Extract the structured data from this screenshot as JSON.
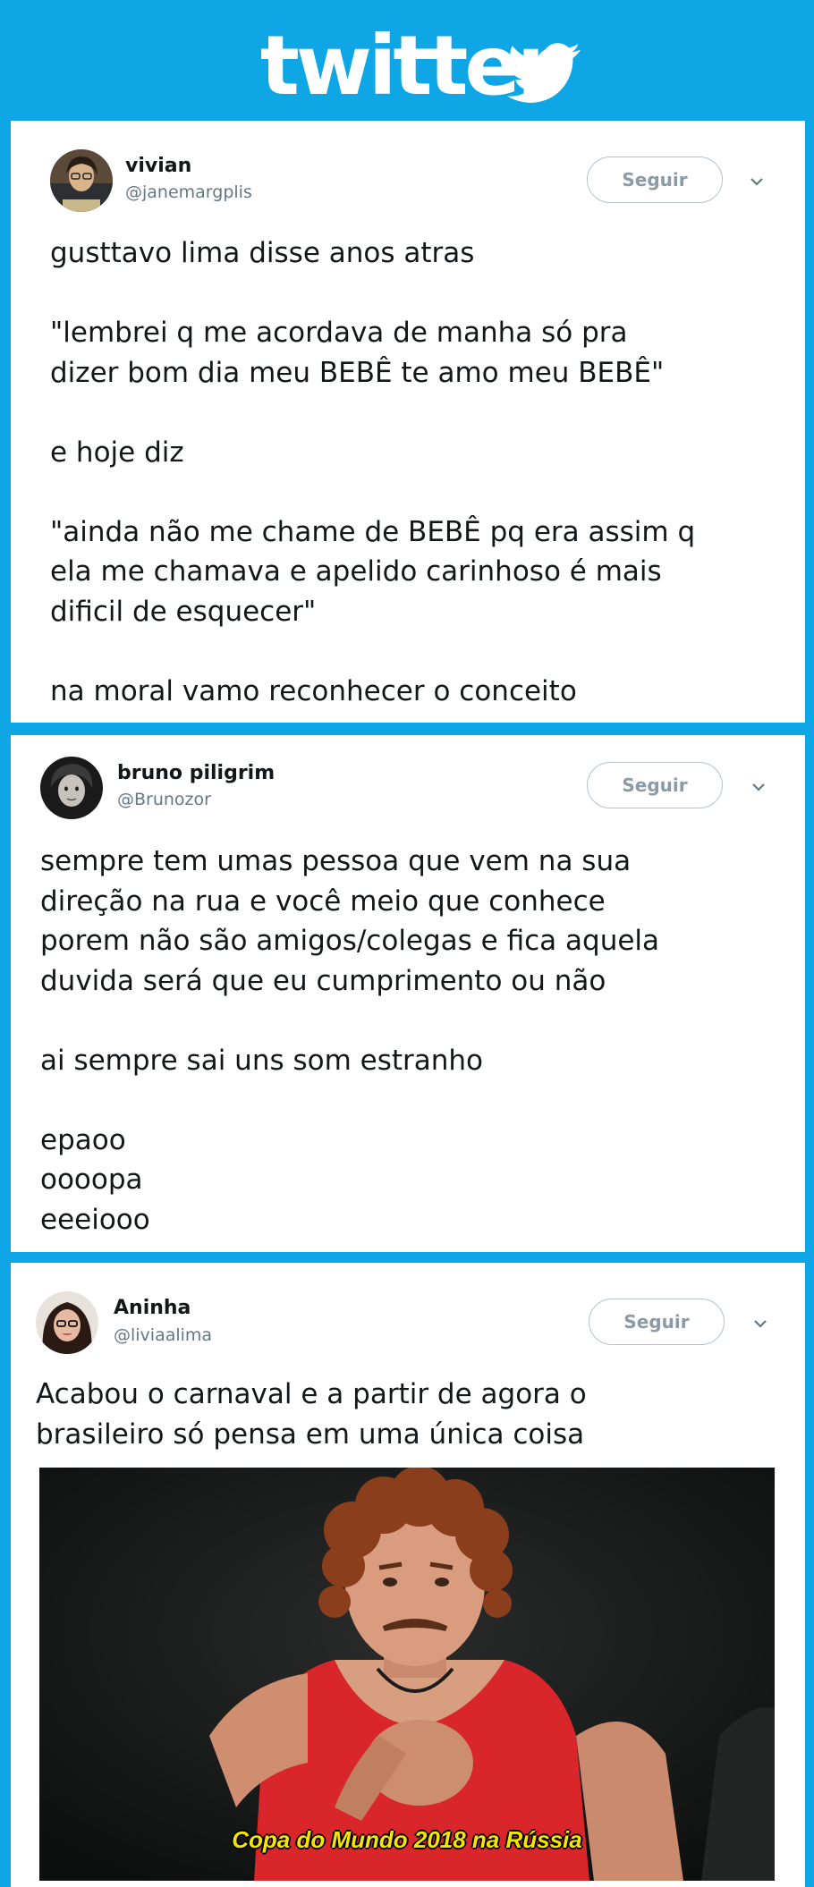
{
  "header": {
    "logo_text": "twitter"
  },
  "tweets": [
    {
      "name": "vivian",
      "handle": "@janemargplis",
      "follow_label": "Seguir",
      "text": "gusttavo lima disse anos atras\n\n\"lembrei q me acordava de manha só pra\ndizer bom dia meu BEBÊ te amo meu BEBÊ\"\n\ne hoje diz\n\n\"ainda não me chame de BEBÊ pq era assim q\nela me chamava e apelido carinhoso é mais\ndificil de esquecer\"\n\nna moral vamo reconhecer o conceito"
    },
    {
      "name": "bruno piligrim",
      "handle": "@Brunozor",
      "follow_label": "Seguir",
      "text": "sempre tem umas pessoa que vem na sua\ndireção na rua e você meio que conhece\nporem não são amigos/colegas e fica aquela\nduvida será que eu cumprimento ou não\n\nai sempre sai uns som estranho\n\nepaoo\noooopa\neeeiooo"
    },
    {
      "name": "Aninha",
      "handle": "@liviaalima",
      "follow_label": "Seguir",
      "text": "Acabou o carnaval e a partir de agora o\nbrasileiro só pensa em uma única coisa",
      "media_caption": "Copa do Mundo 2018 na Rússia"
    }
  ],
  "colors": {
    "twitter_blue": "#0fa6e6",
    "text": "#14171a",
    "handle": "#657786",
    "follow_border": "#b4c2cc"
  },
  "icons": [
    "twitter-bird-icon",
    "chevron-down-icon"
  ]
}
